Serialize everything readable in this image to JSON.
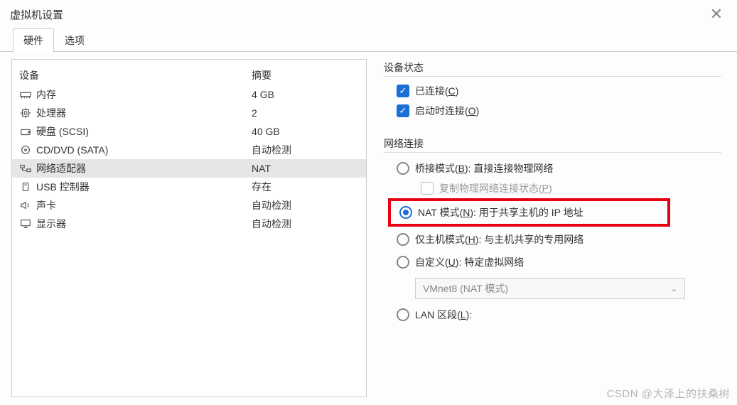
{
  "title": "虚拟机设置",
  "tabs": {
    "hardware": "硬件",
    "options": "选项"
  },
  "columns": {
    "device": "设备",
    "summary": "摘要"
  },
  "devices": [
    {
      "name": "内存",
      "summary": "4 GB",
      "icon": "memory"
    },
    {
      "name": "处理器",
      "summary": "2",
      "icon": "cpu"
    },
    {
      "name": "硬盘 (SCSI)",
      "summary": "40 GB",
      "icon": "disk"
    },
    {
      "name": "CD/DVD (SATA)",
      "summary": "自动检测",
      "icon": "cd"
    },
    {
      "name": "网络适配器",
      "summary": "NAT",
      "icon": "net",
      "selected": true
    },
    {
      "name": "USB 控制器",
      "summary": "存在",
      "icon": "usb"
    },
    {
      "name": "声卡",
      "summary": "自动检测",
      "icon": "sound"
    },
    {
      "name": "显示器",
      "summary": "自动检测",
      "icon": "display"
    }
  ],
  "status": {
    "label": "设备状态",
    "connected": {
      "label": "已连接(C)",
      "underline": "C",
      "checked": true
    },
    "connect_on": {
      "label": "启动时连接(O)",
      "underline": "O",
      "checked": true
    }
  },
  "network": {
    "label": "网络连接",
    "bridged": {
      "label": "桥接模式(B): 直接连接物理网络",
      "underline": "B"
    },
    "replicate": {
      "label": "复制物理网络连接状态(P)",
      "underline": "P"
    },
    "nat": {
      "label": "NAT 模式(N): 用于共享主机的 IP 地址",
      "underline": "N"
    },
    "hostonly": {
      "label": "仅主机模式(H): 与主机共享的专用网络",
      "underline": "H"
    },
    "custom": {
      "label": "自定义(U): 特定虚拟网络",
      "underline": "U"
    },
    "dropdown": "VMnet8 (NAT 模式)",
    "lan": {
      "label": "LAN 区段(L):",
      "underline": "L"
    }
  },
  "watermark": "CSDN @大泽上的扶桑树"
}
